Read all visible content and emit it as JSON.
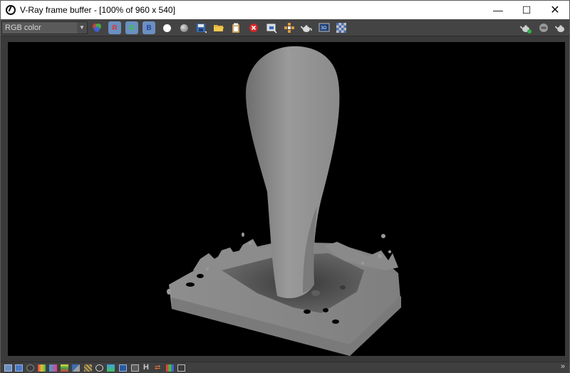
{
  "window": {
    "title": "V-Ray frame buffer - [100% of 960 x 540]",
    "controls": {
      "minimize": "—",
      "maximize": "☐",
      "close": "✕"
    }
  },
  "toolbar": {
    "channel_value": "RGB color",
    "r_label": "R",
    "g_label": "G",
    "b_label": "B"
  },
  "statusbar": {
    "h_label": "H",
    "more": "»"
  },
  "colors": {
    "toolbar_bg": "#444444",
    "render_bg": "#000000",
    "fluid": "#8c8c8c",
    "channel_btn": "#6b8fc0",
    "stop_red": "#d62828"
  }
}
